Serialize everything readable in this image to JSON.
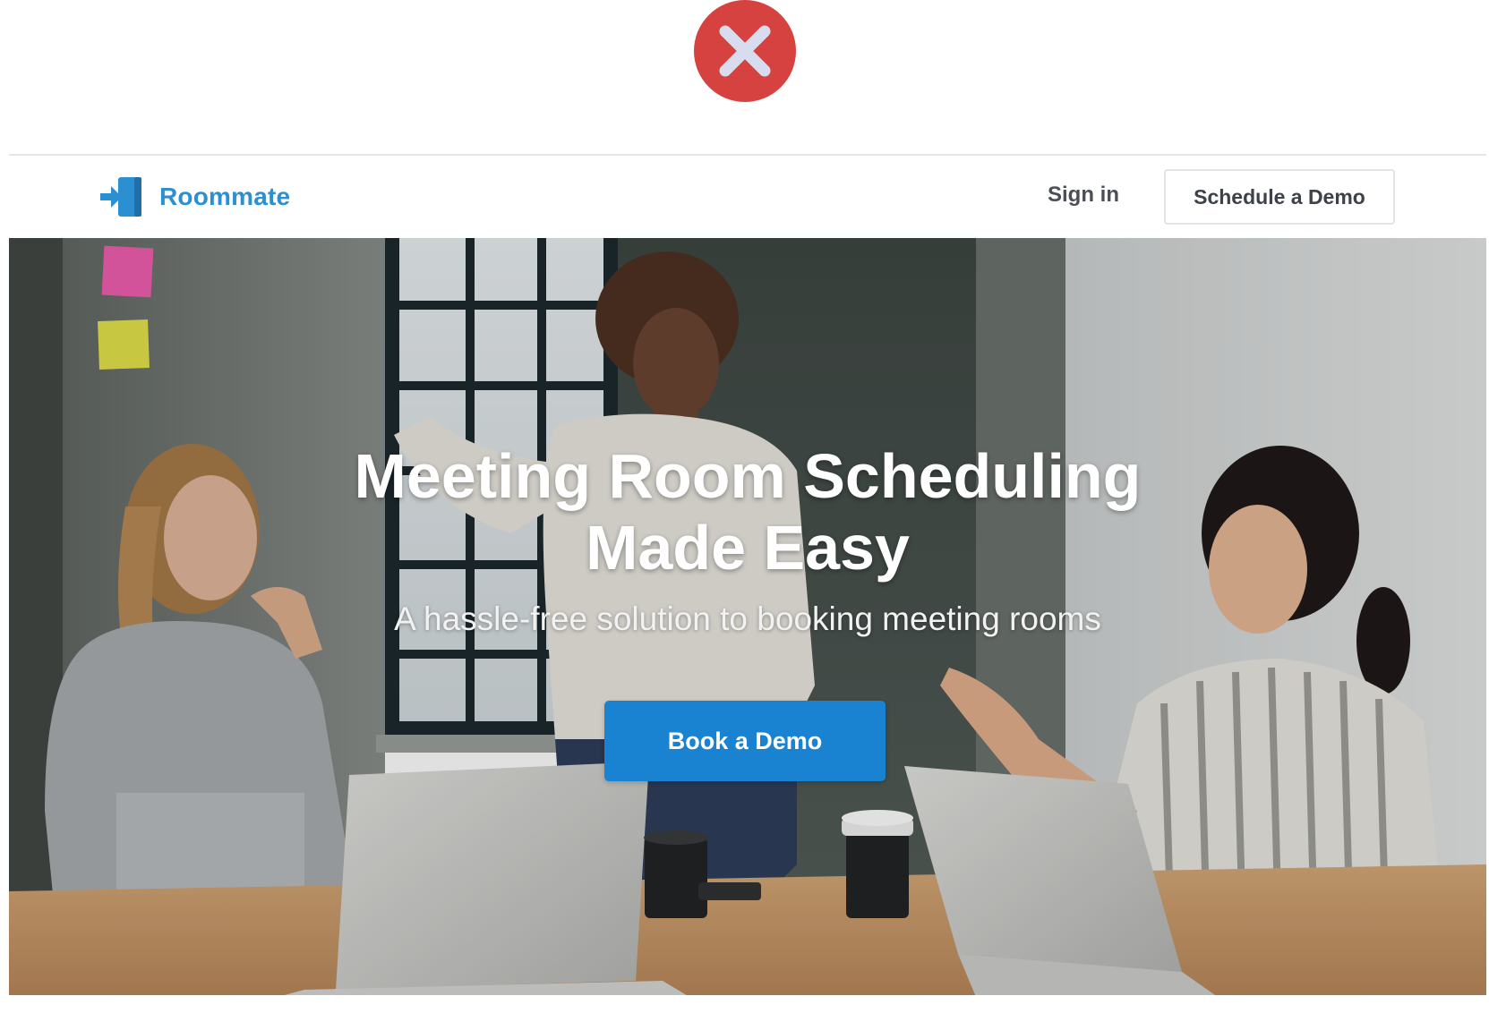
{
  "brand": {
    "name": "Roommate",
    "color": "#2c8fd2"
  },
  "overlay": {
    "close_icon": "close-icon",
    "close_color": "#d6423f"
  },
  "nav": {
    "sign_in": "Sign in",
    "schedule_demo": "Schedule a Demo"
  },
  "hero": {
    "title_line1": "Meeting Room Scheduling",
    "title_line2": "Made Easy",
    "subtitle": "A hassle-free solution to booking meeting rooms",
    "cta": "Book a Demo",
    "cta_color": "#1a83d1"
  }
}
